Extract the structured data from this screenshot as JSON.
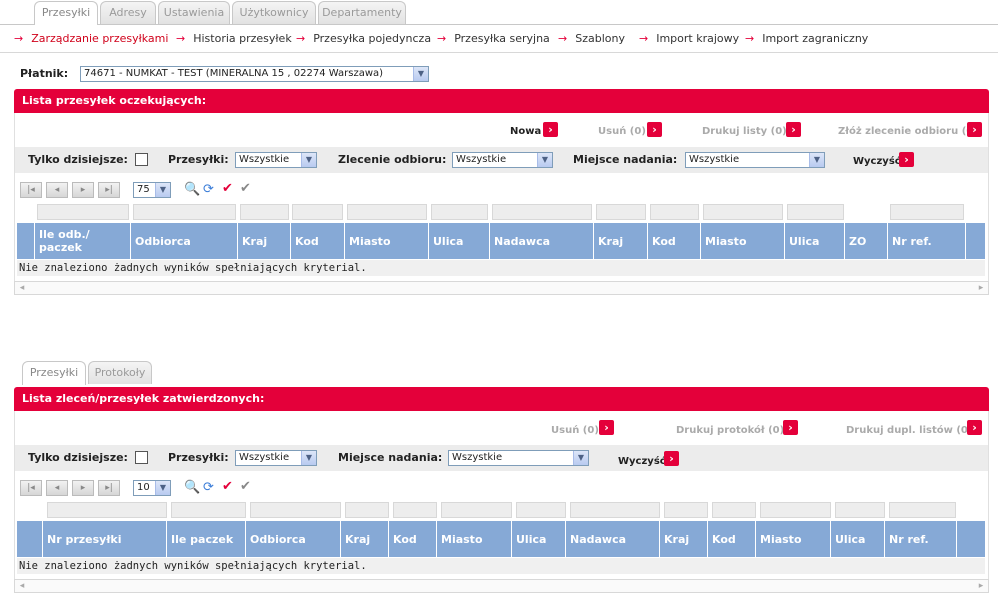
{
  "top_tabs": [
    "Przesyłki",
    "Adresy",
    "Ustawienia",
    "Użytkownicy",
    "Departamenty"
  ],
  "sub_nav": [
    "Zarządzanie przesyłkami",
    "Historia przesyłek",
    "Przesyłka pojedyncza",
    "Przesyłka seryjna",
    "Szablony",
    "Import krajowy",
    "Import zagraniczny"
  ],
  "payer": {
    "label": "Płatnik:",
    "value": "74671 - NUMKAT - TEST (MINERALNA 15 , 02274 Warszawa)"
  },
  "pending": {
    "title": "Lista przesyłek oczekujących:",
    "actions": {
      "new": "Nowa",
      "delete": "Usuń (0)",
      "print": "Drukuj listy (0)",
      "order": "Złóż zlecenie odbioru (0)"
    },
    "filters": {
      "today": "Tylko dzisiejsze:",
      "shipments": "Przesyłki:",
      "shipments_value": "Wszystkie",
      "pickup": "Zlecenie odbioru:",
      "pickup_value": "Wszystkie",
      "place": "Miejsce nadania:",
      "place_value": "Wszystkie",
      "clear": "Wyczyść"
    },
    "page_size": "75",
    "columns": [
      "Ile odb./ paczek",
      "Odbiorca",
      "Kraj",
      "Kod",
      "Miasto",
      "Ulica",
      "Nadawca",
      "Kraj",
      "Kod",
      "Miasto",
      "Ulica",
      "ZO",
      "Nr ref."
    ],
    "empty": "Nie znaleziono żadnych wyników spełniających kryterial."
  },
  "lower_tabs": [
    "Przesyłki",
    "Protokoły"
  ],
  "approved": {
    "title": "Lista zleceń/przesyłek zatwierdzonych:",
    "actions": {
      "delete": "Usuń (0)",
      "print_protocol": "Drukuj protokół (0)",
      "print_dupl": "Drukuj dupl. listów (0)"
    },
    "filters": {
      "today": "Tylko dzisiejsze:",
      "shipments": "Przesyłki:",
      "shipments_value": "Wszystkie",
      "place": "Miejsce nadania:",
      "place_value": "Wszystkie",
      "clear": "Wyczyść"
    },
    "page_size": "10",
    "columns": [
      "Nr przesyłki",
      "Ile paczek",
      "Odbiorca",
      "Kraj",
      "Kod",
      "Miasto",
      "Ulica",
      "Nadawca",
      "Kraj",
      "Kod",
      "Miasto",
      "Ulica",
      "Nr ref."
    ],
    "empty": "Nie znaleziono żadnych wyników spełniających kryterial."
  },
  "colors": {
    "accent": "#e4003a",
    "header_blue": "#86a9d6"
  }
}
